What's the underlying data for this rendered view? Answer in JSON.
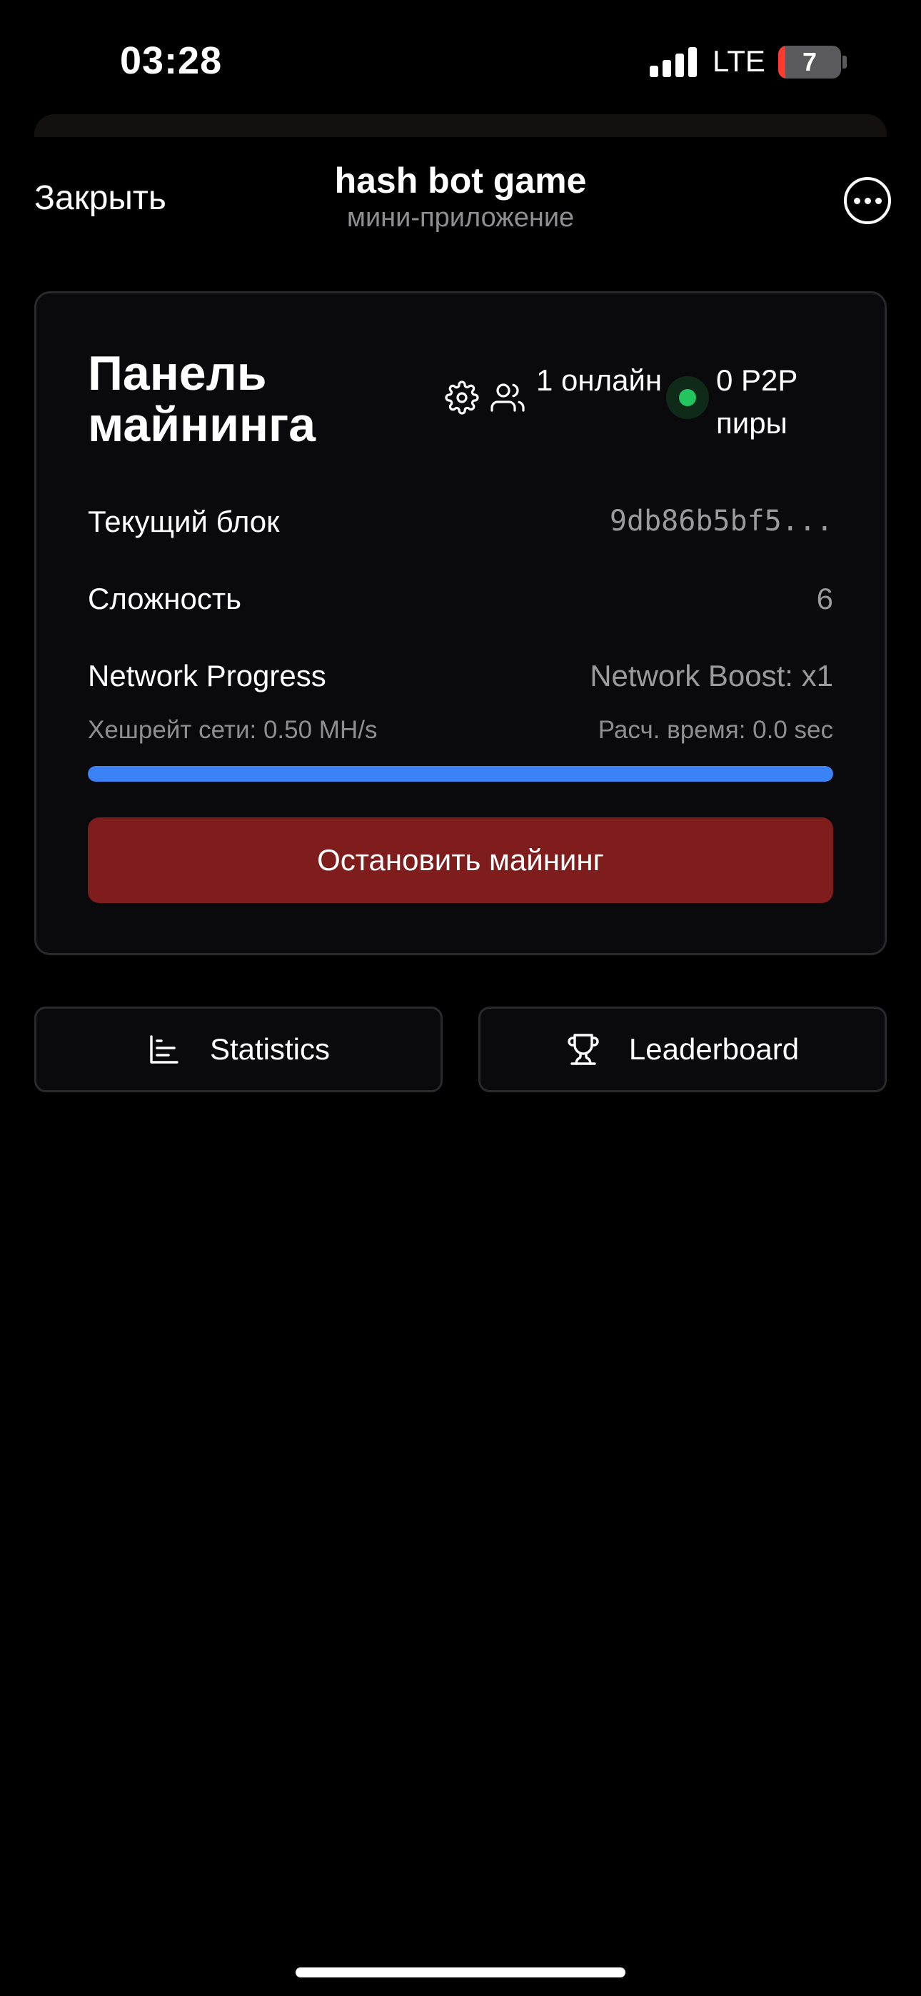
{
  "status_bar": {
    "time": "03:28",
    "network": "LTE",
    "battery": "7"
  },
  "header": {
    "close_label": "Закрыть",
    "title": "hash bot game",
    "subtitle": "мини-приложение"
  },
  "panel": {
    "title": "Панель майнинга",
    "online": "1 онлайн",
    "peers": "0 P2P пиры",
    "rows": {
      "block_label": "Текущий блок",
      "block_value": "9db86b5bf5...",
      "difficulty_label": "Сложность",
      "difficulty_value": "6",
      "progress_label": "Network Progress",
      "boost_value": "Network Boost: x1"
    },
    "hashrate": "Хешрейт сети: 0.50 MH/s",
    "eta": "Расч. время: 0.0 sec",
    "progress": 1.0,
    "stop_button": "Остановить майнинг"
  },
  "nav": {
    "statistics": "Statistics",
    "leaderboard": "Leaderboard"
  },
  "colors": {
    "accent_blue": "#3b82f6",
    "stop_red": "#7f1d1d",
    "online_green": "#22c55e"
  }
}
